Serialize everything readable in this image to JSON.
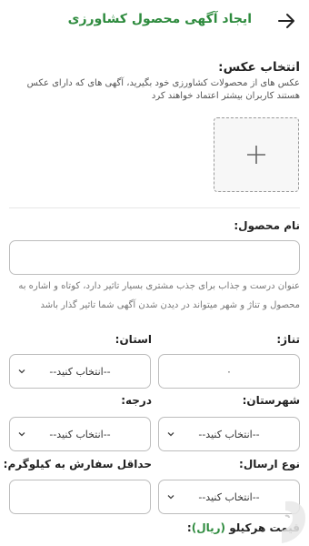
{
  "header": {
    "title": "ایجاد آگهی محصول کشاورزی"
  },
  "photo": {
    "title": "انتخاب عکس:",
    "description": "عکس های از محصولات کشاورزی خود بگیرید، آگهی های که دارای عکس هستند کاربران بیشتر اعتماد خواهند کرد"
  },
  "product_name": {
    "label": "نام محصول:",
    "value": "",
    "hint": "عنوان درست و جذاب برای جذب مشتری بسیار تاثیر دارد، کوتاه و اشاره به محصول و تناژ و شهر میتواند در دیدن شدن آگهی شما تاثیر گذار باشد"
  },
  "tonnage": {
    "label": "تناژ:",
    "value": "۰"
  },
  "province": {
    "label": "استان:",
    "selected": "--انتخاب کنید--"
  },
  "city": {
    "label": "شهرستان:",
    "selected": "--انتخاب کنید--"
  },
  "grade": {
    "label": "درجه:",
    "selected": "--انتخاب کنید--"
  },
  "shipping_type": {
    "label": "نوع ارسال:",
    "selected": "--انتخاب کنید--"
  },
  "min_order": {
    "label": "حداقل سفارش به کیلوگرم:",
    "value": ""
  },
  "price": {
    "label": "قیمت هرکیلو",
    "unit": "(ریال)",
    "label_suffix": ":"
  },
  "colors": {
    "accent": "#2e8b3e",
    "border": "#bdbdbd"
  }
}
